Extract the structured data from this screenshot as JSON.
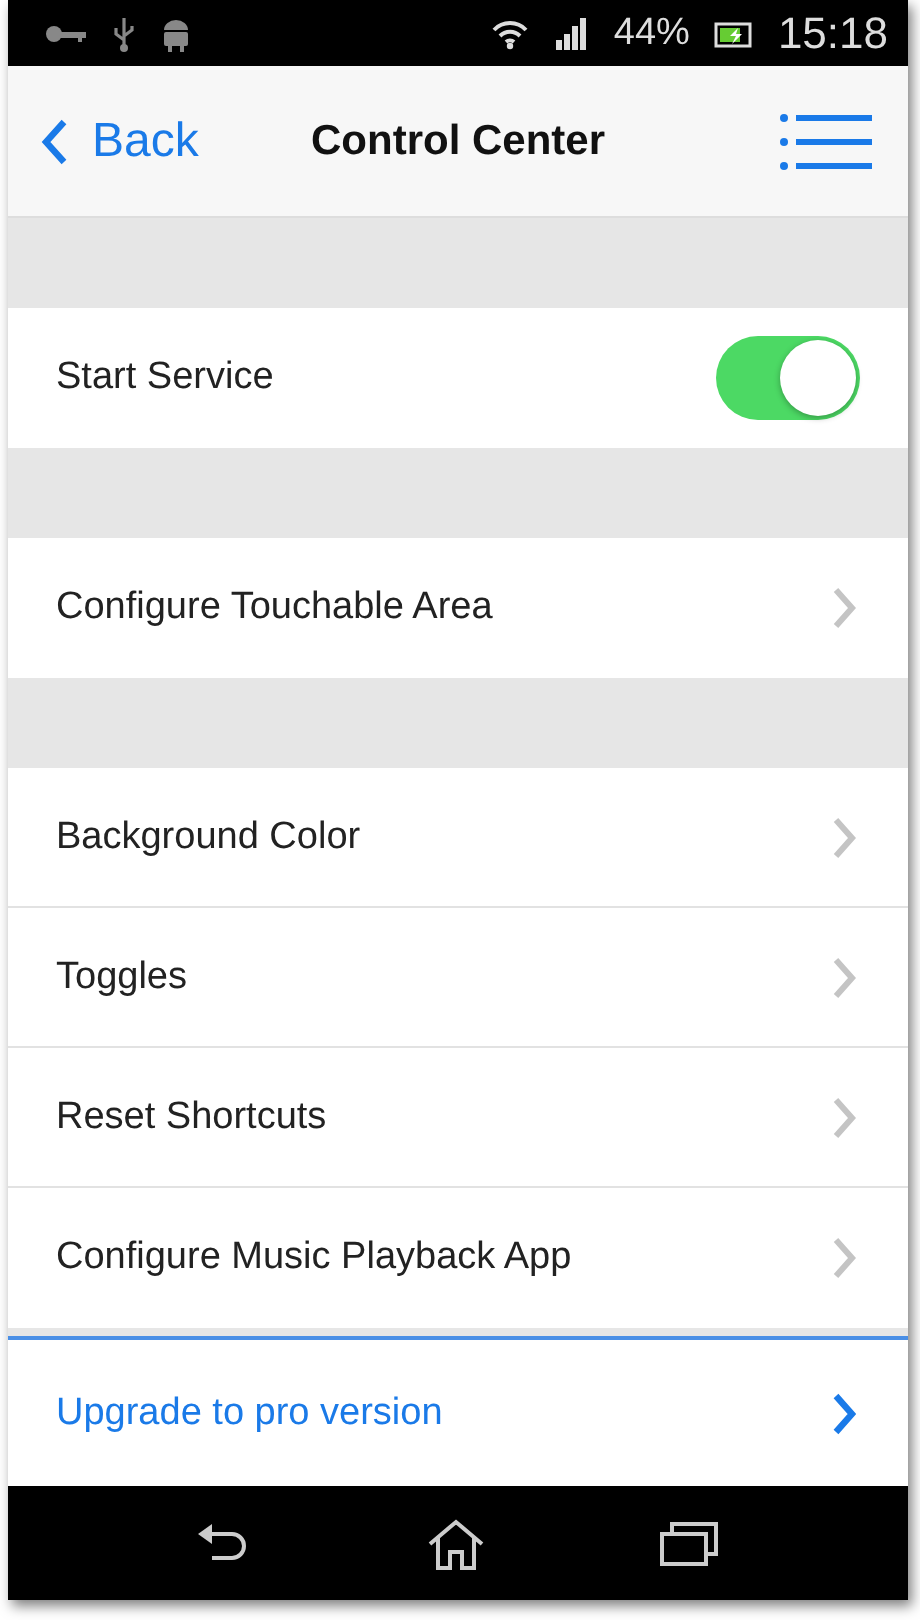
{
  "status_bar": {
    "battery": "44%",
    "time": "15:18"
  },
  "header": {
    "back": "Back",
    "title": "Control Center"
  },
  "sections": [
    [
      {
        "kind": "toggle",
        "label": "Start Service",
        "on": true
      }
    ],
    [
      {
        "kind": "link",
        "label": "Configure Touchable Area"
      }
    ],
    [
      {
        "kind": "link",
        "label": "Background Color"
      },
      {
        "kind": "link",
        "label": "Toggles"
      },
      {
        "kind": "link",
        "label": "Reset Shortcuts"
      },
      {
        "kind": "link",
        "label": "Configure Music Playback App"
      }
    ]
  ],
  "upgrade": {
    "label": "Upgrade to pro version"
  }
}
